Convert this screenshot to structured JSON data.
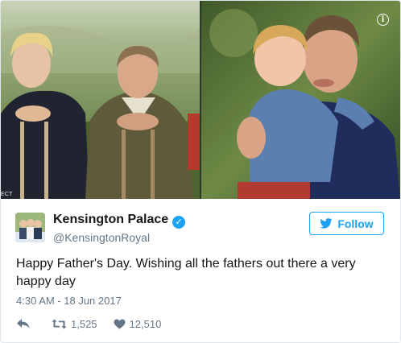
{
  "media": {
    "credit_text": "ECT",
    "info_label": "i"
  },
  "author": {
    "name": "Kensington Palace",
    "handle": "@KensingtonRoyal",
    "verified_icon": "verified-badge-icon"
  },
  "follow_button": {
    "label": "Follow",
    "icon": "twitter-bird-icon"
  },
  "tweet": {
    "text": "Happy Father's Day. Wishing all the fathers out there a very happy day",
    "timestamp": "4:30 AM - 18 Jun 2017"
  },
  "actions": {
    "reply_icon": "reply-icon",
    "retweet_icon": "retweet-icon",
    "retweet_count": "1,525",
    "like_icon": "heart-icon",
    "like_count": "12,510"
  },
  "colors": {
    "accent": "#1da1f2",
    "text": "#14171a",
    "secondary": "#657786",
    "border": "#e1e8ed"
  }
}
